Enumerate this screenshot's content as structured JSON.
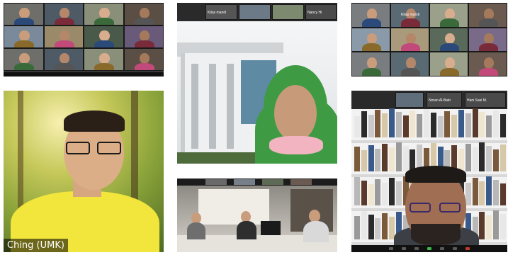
{
  "panels": {
    "top_left": {
      "participants": [
        "",
        "",
        "",
        "",
        "",
        "",
        "",
        "",
        "",
        "",
        "",
        "",
        "",
        "",
        ""
      ]
    },
    "top_middle": {
      "top_bar_labels": [
        "Kitas mandi",
        "Nancy Hi"
      ]
    },
    "top_right": {
      "top_bar_labels": [
        "Kitas mandi"
      ]
    },
    "left_speaker": {
      "name_tag": "Ching (UMK)"
    },
    "right_speaker": {
      "top_bar_labels": [
        "Noran Al-Bakr",
        "Hani Sasi M."
      ]
    }
  },
  "colors": {
    "zoom_toolbar": "#111111",
    "zoom_green": "#3cb94a",
    "forest_green": "#8aa33a",
    "hijab_green": "#3e9a43",
    "yellow_shirt": "#f2e53c"
  },
  "icons": [
    "microphone-icon",
    "video-icon",
    "participants-icon",
    "share-screen-icon",
    "chat-icon",
    "record-icon",
    "leave-icon"
  ]
}
